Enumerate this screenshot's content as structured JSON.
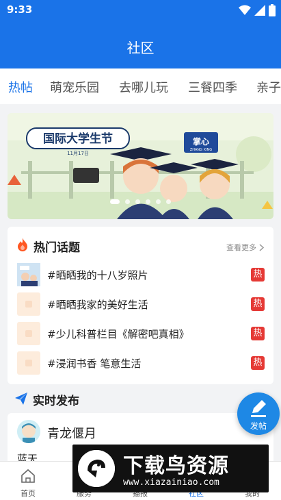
{
  "status_bar": {
    "time": "9:33"
  },
  "header": {
    "title": "社区"
  },
  "tabs": [
    {
      "label": "热帖",
      "active": true
    },
    {
      "label": "萌宠乐园"
    },
    {
      "label": "去哪儿玩"
    },
    {
      "label": "三餐四季"
    },
    {
      "label": "亲子"
    }
  ],
  "banner": {
    "headline": "国际大学生节",
    "date": "11月17日",
    "brand": "掌心",
    "brand_sub": "ZHANG XING",
    "slide_count": 6,
    "active_slide": 0
  },
  "hot_topics": {
    "title": "热门话题",
    "more_label": "查看更多",
    "hot_badge": "热",
    "items": [
      {
        "text": "#晒晒我的十八岁照片"
      },
      {
        "text": "#晒晒我家的美好生活"
      },
      {
        "text": "#少儿科普栏目《解密吧真相》"
      },
      {
        "text": "#浸润书香 笔意生活"
      }
    ]
  },
  "live": {
    "title": "实时发布",
    "post": {
      "user": "青龙偃月",
      "text": "蓝天"
    }
  },
  "fab": {
    "label": "发帖"
  },
  "bottom_nav": [
    {
      "label": "首页"
    },
    {
      "label": "服务"
    },
    {
      "label": "播报"
    },
    {
      "label": "社区",
      "active": true
    },
    {
      "label": "我的"
    }
  ],
  "watermark": {
    "title": "下载鸟资源",
    "url": "www.xiazainiao.com"
  },
  "colors": {
    "primary": "#1a73e8",
    "hot": "#e53935",
    "fire": "#ff5722"
  }
}
